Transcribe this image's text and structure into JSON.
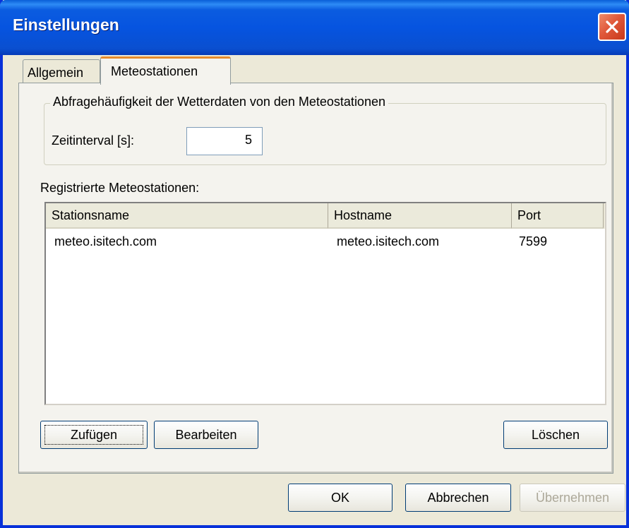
{
  "window": {
    "title": "Einstellungen"
  },
  "tabs": [
    {
      "label": "Allgemein"
    },
    {
      "label": "Meteostationen"
    }
  ],
  "group": {
    "label": "Abfragehäufigkeit der Wetterdaten von den Meteostationen",
    "interval_label": "Zeitinterval [s]:",
    "interval_value": "5"
  },
  "list": {
    "label": "Registrierte Meteostationen:",
    "columns": [
      "Stationsname",
      "Hostname",
      "Port"
    ],
    "rows": [
      [
        "meteo.isitech.com",
        "meteo.isitech.com",
        "7599"
      ]
    ]
  },
  "buttons": {
    "add": "Zufügen",
    "edit": "Bearbeiten",
    "delete": "Löschen",
    "ok": "OK",
    "cancel": "Abbrechen",
    "apply": "Übernehmen"
  },
  "icons": {
    "close": "close-icon"
  }
}
